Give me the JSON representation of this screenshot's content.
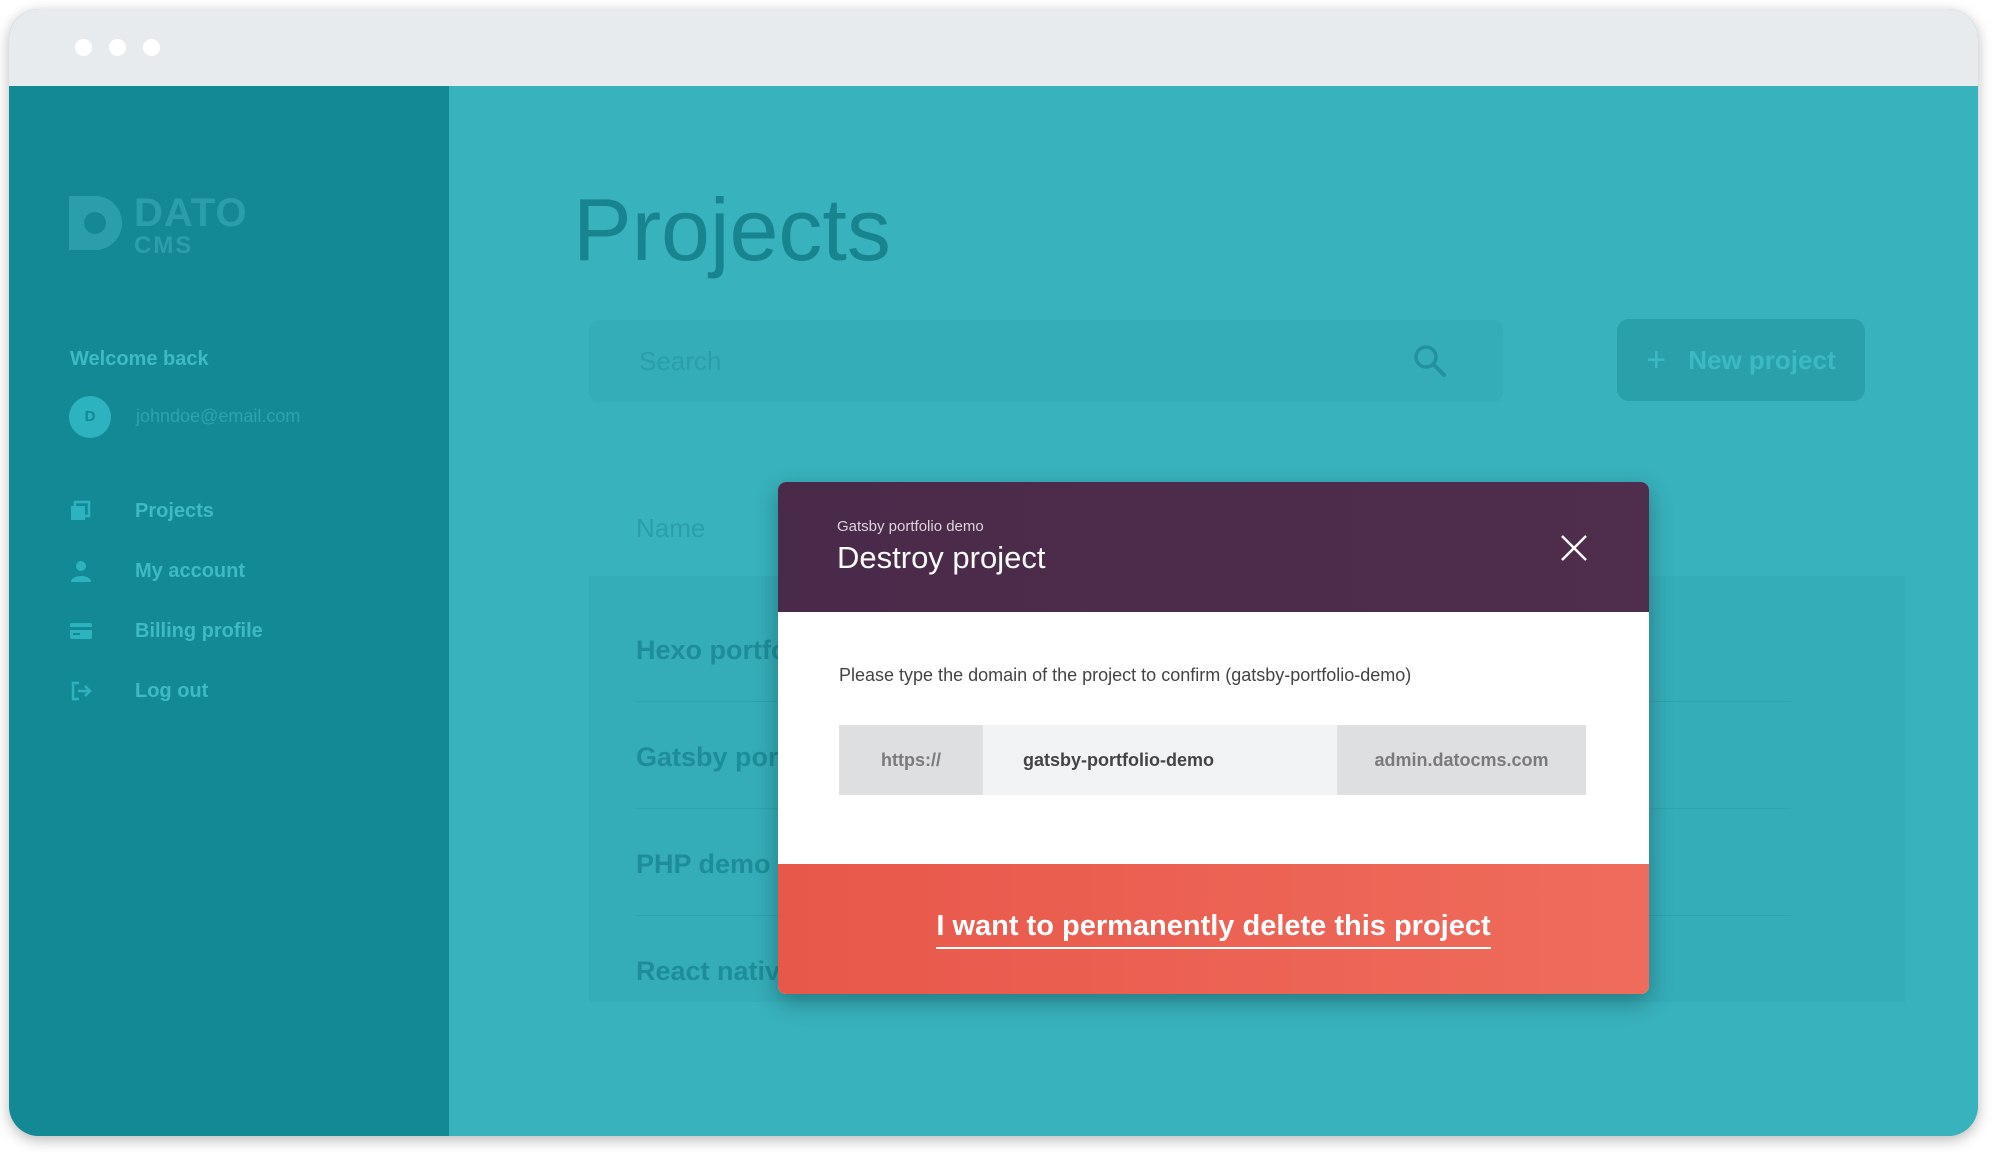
{
  "brand": {
    "name": "DATO",
    "sub": "CMS"
  },
  "sidebar": {
    "welcome": "Welcome back",
    "avatar_initial": "D",
    "email": "johndoe@email.com",
    "items": [
      {
        "label": "Projects",
        "icon": "projects-icon"
      },
      {
        "label": "My account",
        "icon": "user-icon"
      },
      {
        "label": "Billing profile",
        "icon": "credit-card-icon"
      },
      {
        "label": "Log out",
        "icon": "logout-icon"
      }
    ]
  },
  "main": {
    "title": "Projects",
    "search": {
      "placeholder": "Search",
      "icon": "search-icon"
    },
    "new_project": {
      "plus": "+",
      "label": "New project"
    },
    "table": {
      "column_name": "Name",
      "rows": [
        "Hexo portfol",
        "Gatsby portf",
        "PHP demo fo",
        "React native"
      ]
    }
  },
  "modal": {
    "subtitle": "Gatsby portfolio demo",
    "title": "Destroy project",
    "prompt": "Please type the domain of the project to confirm (gatsby-portfolio-demo)",
    "prefix": "https://",
    "domain_value": "gatsby-portfolio-demo",
    "suffix": "admin.datocms.com",
    "confirm_label": "I want to permanently delete this project"
  },
  "colors": {
    "sidebar_bg": "#148996",
    "main_bg": "#38b2bd",
    "modal_header": "#4a2a4a",
    "danger": "#e8574a",
    "titlebar": "#e8ebee"
  }
}
